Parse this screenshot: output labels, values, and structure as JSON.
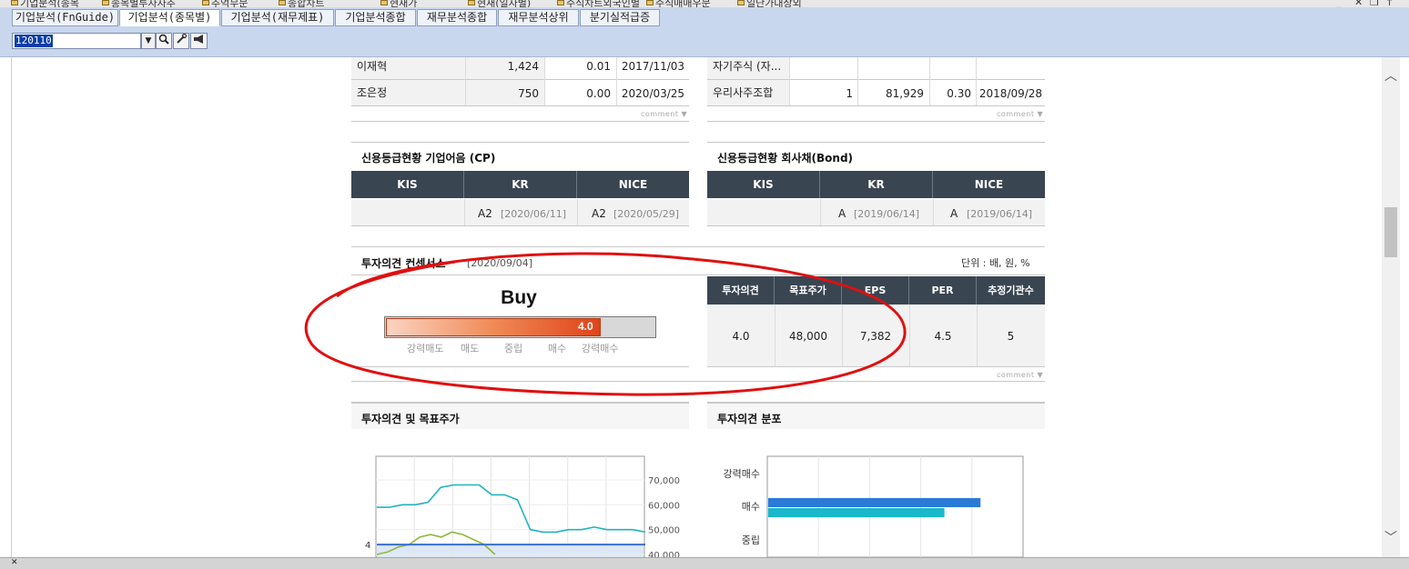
{
  "top_strip": {
    "items": [
      "기업분석(종목",
      "종목별투자자추",
      "추억무문",
      "종합차트",
      "현재가",
      "현재(일자별)",
      "주식차트외국인별",
      "주식매매우문",
      "일단가대상외"
    ]
  },
  "tabs": [
    {
      "label": "기업분석(FnGuide)",
      "active": false
    },
    {
      "label": "기업분석(종목별)",
      "active": true
    },
    {
      "label": "기업분석(재무제표)",
      "active": false
    },
    {
      "label": "기업분석종합",
      "active": false
    },
    {
      "label": "재무분석종합",
      "active": false
    },
    {
      "label": "재무분석상위",
      "active": false
    },
    {
      "label": "분기실적급증",
      "active": false
    }
  ],
  "code_input": {
    "value": "120110"
  },
  "shareholders_left": [
    {
      "name": "이재혁",
      "shares": "1,424",
      "pct": "0.01",
      "date": "2017/11/03"
    },
    {
      "name": "조은정",
      "shares": "750",
      "pct": "0.00",
      "date": "2020/03/25"
    }
  ],
  "shareholders_right": [
    {
      "name": "자기주식 (자...",
      "count": "",
      "shares": "",
      "pct": "",
      "date": ""
    },
    {
      "name": "우리사주조합",
      "count": "1",
      "shares": "81,929",
      "pct": "0.30",
      "date": "2018/09/28"
    }
  ],
  "comment_label": "comment",
  "credit_cp": {
    "title": "신용등급현황 기업어음 (CP)",
    "headers": [
      "KIS",
      "KR",
      "NICE"
    ],
    "values": [
      {
        "grade": "",
        "date": ""
      },
      {
        "grade": "A2",
        "date": "[2020/06/11]"
      },
      {
        "grade": "A2",
        "date": "[2020/05/29]"
      }
    ]
  },
  "credit_bond": {
    "title": "신용등급현황 회사채(Bond)",
    "headers": [
      "KIS",
      "KR",
      "NICE"
    ],
    "values": [
      {
        "grade": "",
        "date": ""
      },
      {
        "grade": "A",
        "date": "[2019/06/14]"
      },
      {
        "grade": "A",
        "date": "[2019/06/14]"
      }
    ]
  },
  "consensus": {
    "title": "투자의견 컨센서스",
    "date": "[2020/09/04]",
    "unit": "단위 : 배, 원, %",
    "opinion": "Buy",
    "score": "4.0",
    "score_fraction": 0.8,
    "scale_labels": [
      "강력매도",
      "매도",
      "중립",
      "매수",
      "강력매수"
    ],
    "headers": [
      "투자의견",
      "목표주가",
      "EPS",
      "PER",
      "추정기관수"
    ],
    "values": [
      "4.0",
      "48,000",
      "7,382",
      "4.5",
      "5"
    ]
  },
  "opinion_target_chart": {
    "title": "투자의견 및 목표주가",
    "y_ticks": [
      "70,000",
      "60,000",
      "50,000",
      "40,000"
    ],
    "left_tick": "4"
  },
  "opinion_dist_chart": {
    "title": "투자의견 분포",
    "categories": [
      "강력매수",
      "매수",
      "중립"
    ]
  },
  "chart_data": [
    {
      "type": "line",
      "title": "투자의견 및 목표주가",
      "ylim": [
        40000,
        70000
      ],
      "yticks": [
        70000,
        60000,
        50000,
        40000
      ],
      "series": [
        {
          "color": "#1fb3c4",
          "values": [
            59000,
            59000,
            60000,
            60000,
            61000,
            67000,
            68000,
            68000,
            68000,
            64000,
            64000,
            62000,
            50000,
            49000,
            49000,
            50000,
            50000,
            51000,
            50000,
            50000,
            50000,
            49000
          ]
        },
        {
          "color": "#8cb83c",
          "values": [
            40000,
            41000,
            43000,
            44000,
            47000,
            48000,
            47000,
            49000,
            48000,
            46000,
            44000,
            40000
          ]
        },
        {
          "color": "#3a6fd0",
          "values": [
            44000,
            44000,
            44000,
            44000,
            44000,
            44000,
            44000,
            44000,
            44000,
            44000,
            44000,
            44000,
            44000,
            44000,
            44000,
            44000,
            44000,
            44000,
            44000,
            44000,
            44000,
            44000
          ]
        }
      ]
    },
    {
      "type": "bar",
      "title": "투자의견 분포",
      "categories": [
        "강력매수",
        "매수",
        "중립"
      ],
      "series": [
        {
          "color": "#2a7ad8",
          "values": [
            0,
            100,
            0
          ]
        },
        {
          "color": "#19b8cc",
          "values": [
            0,
            83,
            0
          ]
        }
      ]
    }
  ],
  "colors": {
    "accent": "#e0431a",
    "header_dark": "#3a4552",
    "tabbar": "#c9d7ee",
    "annotation_red": "#e01010"
  }
}
